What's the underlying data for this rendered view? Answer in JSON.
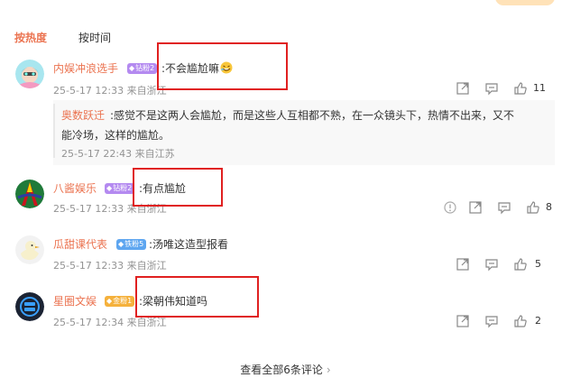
{
  "sort_tabs": [
    {
      "label": "按热度",
      "active": true
    },
    {
      "label": "按时间",
      "active": false
    }
  ],
  "comments": [
    {
      "user": "内娱冲浪选手",
      "badge": "钻粉2",
      "text": ":不会尴尬嘛",
      "emoji": "laugh-emoji",
      "meta": "25-5-17 12:33 来自浙江",
      "likes": "11",
      "reply": {
        "user": "奥数跃迁",
        "text_line1": ":感觉不是这两人会尴尬，而是这些人互相都不熟，在一众镜头下，热情不出来，又不",
        "text_line2": "能冷场，这样的尴尬。",
        "meta": "25-5-17 22:43 来自江苏"
      }
    },
    {
      "user": "八酱娱乐",
      "badge": "钻粉2",
      "text": ":有点尴尬",
      "meta": "25-5-17 12:33 来自浙江",
      "likes": "8"
    },
    {
      "user": "瓜甜课代表",
      "badge": "铁粉5",
      "text": ":汤唯这造型报看",
      "meta": "25-5-17 12:33 来自浙江",
      "likes": "5"
    },
    {
      "user": "星圈文娱",
      "badge": "金粉1",
      "text": ":梁朝伟知道吗",
      "meta": "25-5-17 12:34 来自浙江",
      "likes": "2"
    }
  ],
  "footer": {
    "view_all": "查看全部6条评论"
  },
  "colors": {
    "accent": "#eb7350",
    "highlight": "#e02020",
    "meta": "#939393"
  },
  "icons": [
    "share-icon",
    "comment-icon",
    "like-icon",
    "report-icon"
  ]
}
